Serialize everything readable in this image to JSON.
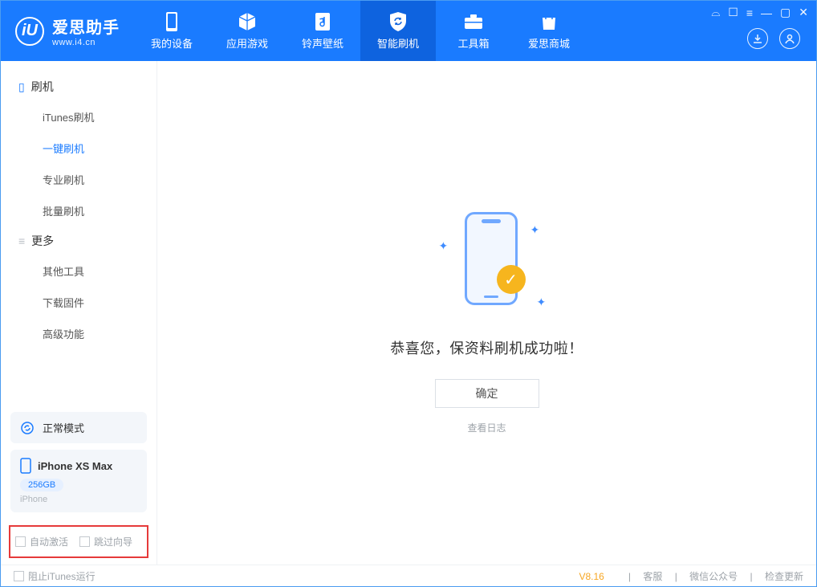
{
  "app": {
    "name_cn": "爱思助手",
    "url": "www.i4.cn"
  },
  "nav": {
    "tabs": [
      {
        "label": "我的设备"
      },
      {
        "label": "应用游戏"
      },
      {
        "label": "铃声壁纸"
      },
      {
        "label": "智能刷机"
      },
      {
        "label": "工具箱"
      },
      {
        "label": "爱思商城"
      }
    ]
  },
  "sidebar": {
    "group_flash": "刷机",
    "items_flash": [
      {
        "label": "iTunes刷机"
      },
      {
        "label": "一键刷机"
      },
      {
        "label": "专业刷机"
      },
      {
        "label": "批量刷机"
      }
    ],
    "group_more": "更多",
    "items_more": [
      {
        "label": "其他工具"
      },
      {
        "label": "下载固件"
      },
      {
        "label": "高级功能"
      }
    ]
  },
  "device": {
    "mode": "正常模式",
    "name": "iPhone XS Max",
    "storage": "256GB",
    "type": "iPhone"
  },
  "options": {
    "auto_activate": "自动激活",
    "skip_guide": "跳过向导"
  },
  "main": {
    "headline": "恭喜您，保资料刷机成功啦！",
    "ok_label": "确定",
    "log_link": "查看日志"
  },
  "footer": {
    "block_itunes": "阻止iTunes运行",
    "version": "V8.16",
    "links": [
      "客服",
      "微信公众号",
      "检查更新"
    ]
  }
}
